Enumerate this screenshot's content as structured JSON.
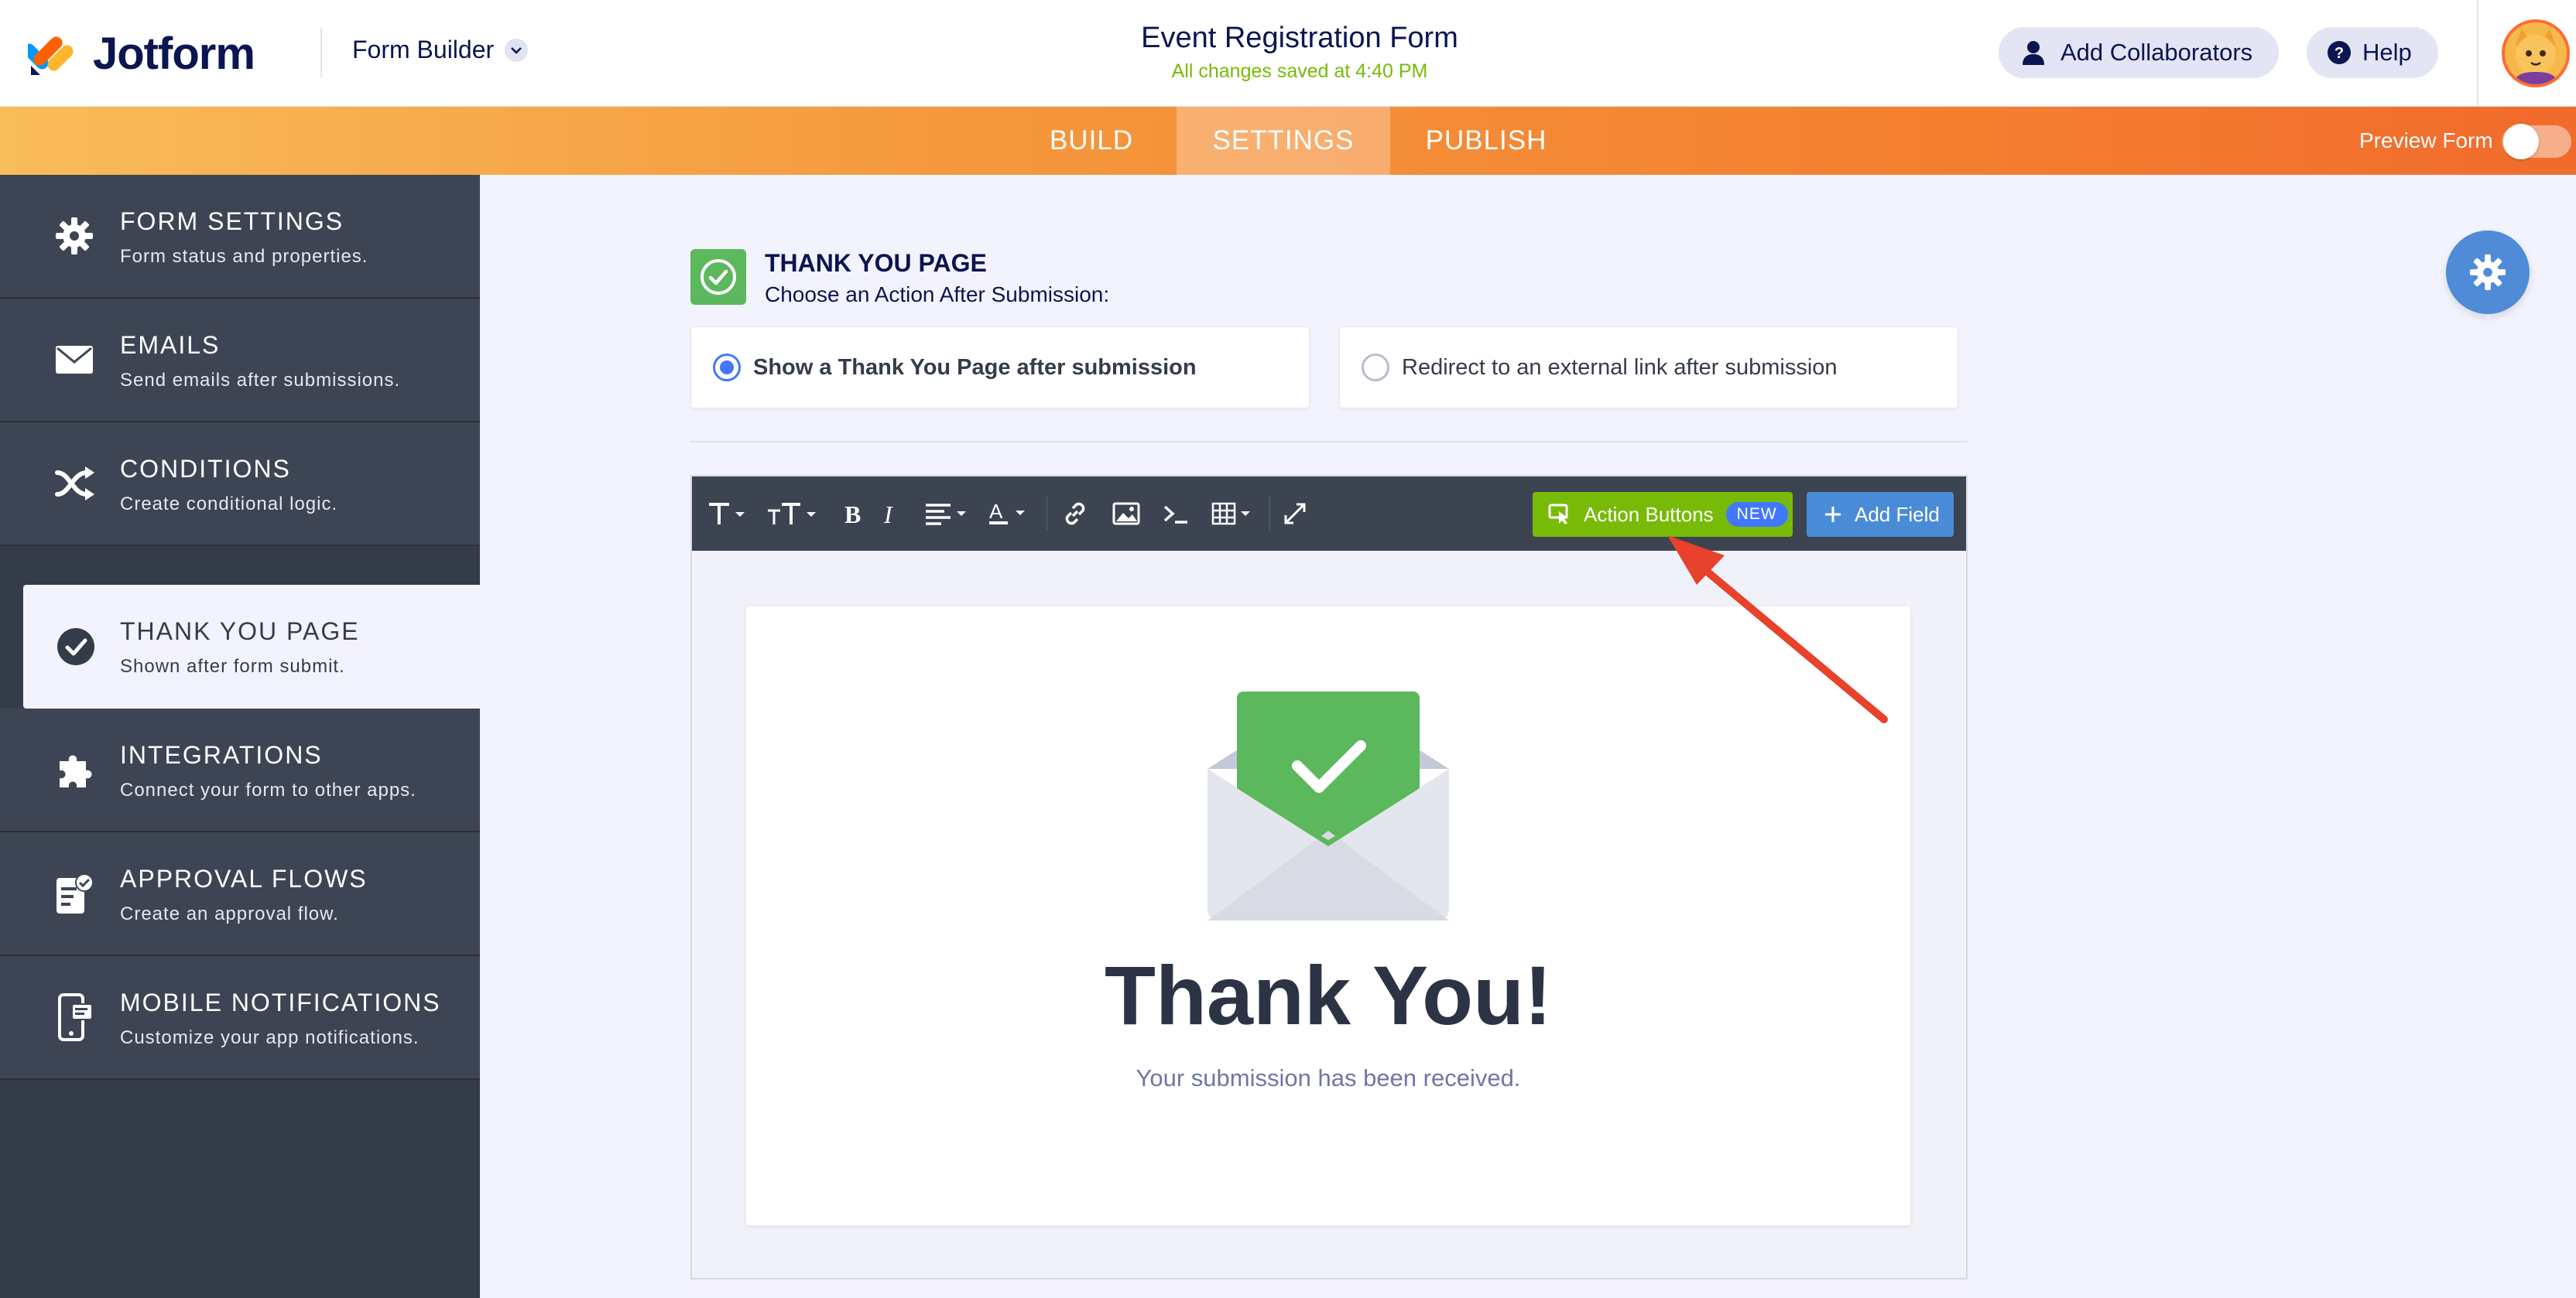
{
  "header": {
    "brand": "Jotform",
    "builder_label": "Form Builder",
    "form_title": "Event Registration Form",
    "saved_status": "All changes saved at 4:40 PM",
    "collaborators_label": "Add Collaborators",
    "help_label": "Help"
  },
  "nav": {
    "tabs": [
      {
        "label": "BUILD"
      },
      {
        "label": "SETTINGS",
        "active": true
      },
      {
        "label": "PUBLISH"
      }
    ],
    "preview_label": "Preview Form"
  },
  "sidebar": {
    "items": [
      {
        "title": "FORM SETTINGS",
        "subtitle": "Form status and properties.",
        "icon": "gear-icon"
      },
      {
        "title": "EMAILS",
        "subtitle": "Send emails after submissions.",
        "icon": "envelope-icon"
      },
      {
        "title": "CONDITIONS",
        "subtitle": "Create conditional logic.",
        "icon": "shuffle-icon"
      },
      {
        "title": "THANK YOU PAGE",
        "subtitle": "Shown after form submit.",
        "icon": "check-circle-icon",
        "active": true
      },
      {
        "title": "INTEGRATIONS",
        "subtitle": "Connect your form to other apps.",
        "icon": "puzzle-icon"
      },
      {
        "title": "APPROVAL FLOWS",
        "subtitle": "Create an approval flow.",
        "icon": "approval-doc-icon"
      },
      {
        "title": "MOBILE NOTIFICATIONS",
        "subtitle": "Customize your app notifications.",
        "icon": "mobile-notification-icon"
      }
    ]
  },
  "main": {
    "section_title": "THANK YOU PAGE",
    "section_subtitle": "Choose an Action After Submission:",
    "options": [
      {
        "label": "Show a Thank You Page after submission",
        "selected": true
      },
      {
        "label": "Redirect to an external link after submission",
        "selected": false
      }
    ],
    "toolbar": {
      "action_buttons_label": "Action Buttons",
      "new_badge": "NEW",
      "add_field_label": "Add Field"
    },
    "preview": {
      "heading": "Thank You!",
      "message": "Your submission has been received."
    }
  },
  "colors": {
    "orange_start": "#f9bc5b",
    "orange_end": "#f16b2c",
    "sidebar_bg": "#343c4a",
    "green": "#78bb07",
    "check_green": "#5cb85c",
    "blue": "#4a8bd8",
    "annotation_red": "#e8412c"
  }
}
